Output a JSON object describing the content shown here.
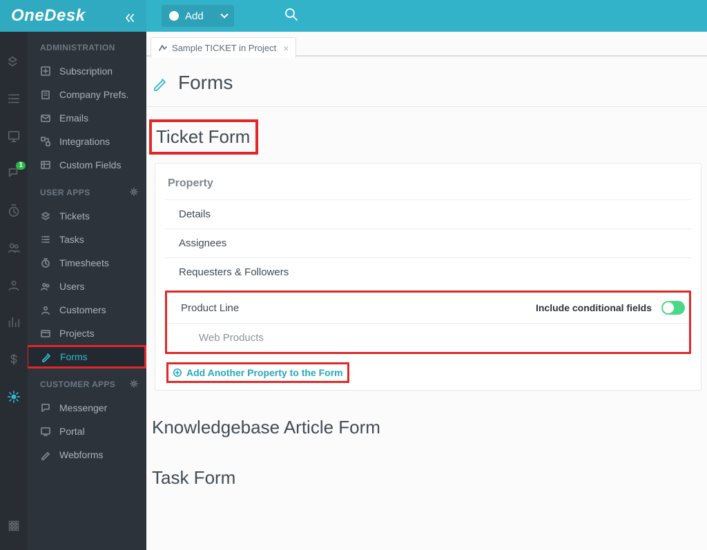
{
  "brand": "OneDesk",
  "topbar": {
    "add_label": "Add"
  },
  "badge_count": "1",
  "sidebar": {
    "section_admin": "ADMINISTRATION",
    "admin_items": [
      {
        "icon": "subscription",
        "label": "Subscription"
      },
      {
        "icon": "company",
        "label": "Company Prefs."
      },
      {
        "icon": "emails",
        "label": "Emails"
      },
      {
        "icon": "integrations",
        "label": "Integrations"
      },
      {
        "icon": "customfields",
        "label": "Custom Fields"
      }
    ],
    "section_user": "USER APPS",
    "user_items": [
      {
        "icon": "tickets",
        "label": "Tickets"
      },
      {
        "icon": "tasks",
        "label": "Tasks"
      },
      {
        "icon": "timesheets",
        "label": "Timesheets"
      },
      {
        "icon": "users",
        "label": "Users"
      },
      {
        "icon": "customers",
        "label": "Customers"
      },
      {
        "icon": "projects",
        "label": "Projects"
      },
      {
        "icon": "forms",
        "label": "Forms",
        "active": true
      }
    ],
    "section_customer": "CUSTOMER APPS",
    "customer_items": [
      {
        "icon": "messenger",
        "label": "Messenger"
      },
      {
        "icon": "portal",
        "label": "Portal"
      },
      {
        "icon": "webforms",
        "label": "Webforms"
      }
    ]
  },
  "tab": {
    "label": "Sample TICKET in Project"
  },
  "page": {
    "title": "Forms",
    "ticket_form": {
      "heading": "Ticket Form",
      "property_header": "Property",
      "rows": {
        "details": "Details",
        "assignees": "Assignees",
        "requesters": "Requesters & Followers",
        "product_line": "Product Line",
        "conditional_label": "Include conditional fields",
        "sub_web": "Web Products"
      },
      "add_link": "Add Another Property to the Form"
    },
    "kb_heading": "Knowledgebase Article Form",
    "task_heading": "Task Form"
  }
}
